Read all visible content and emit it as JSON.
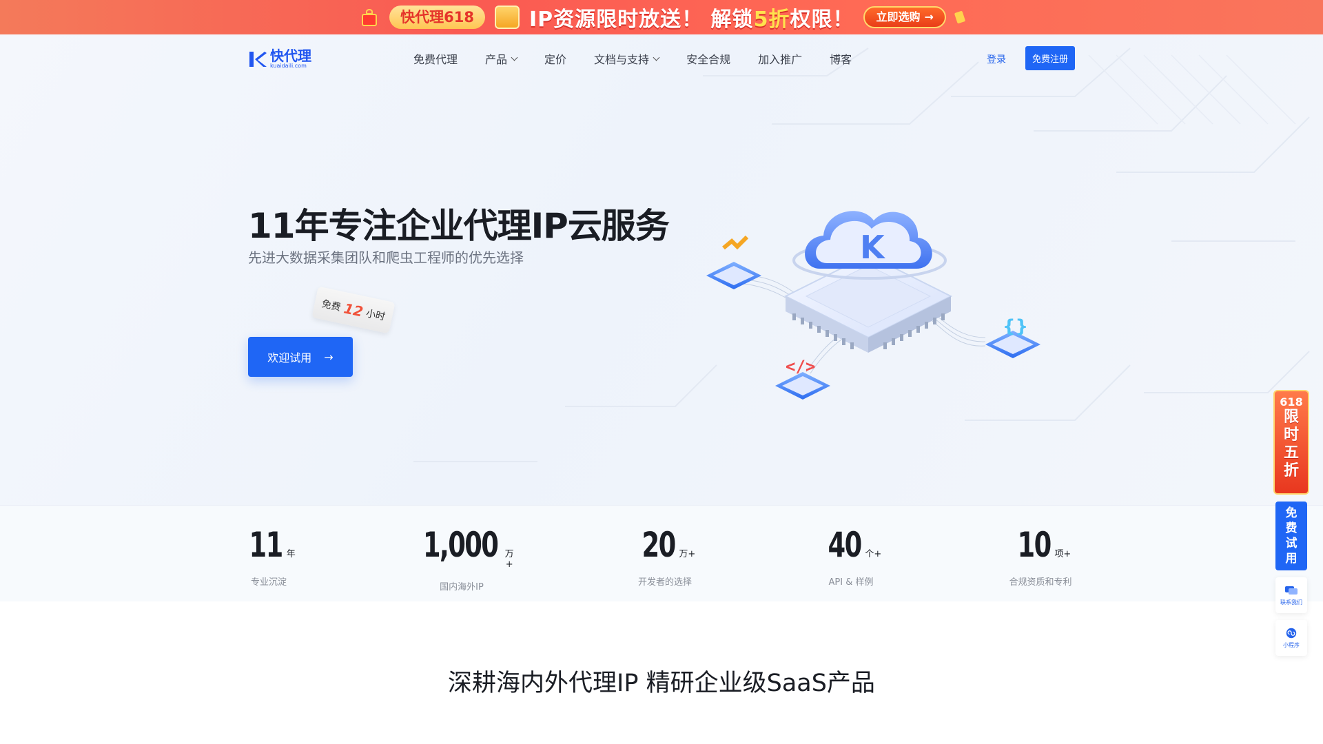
{
  "promo": {
    "chip": "快代理618",
    "headline_prefix": "IP资源限时放送！ 解锁",
    "headline_highlight": "5折",
    "headline_suffix": "权限！",
    "cta": "立即选购",
    "cta_arrow": "→"
  },
  "nav": {
    "logo_name": "快代理",
    "logo_domain": "kuaidaili.com",
    "items": [
      {
        "label": "免费代理",
        "dropdown": false
      },
      {
        "label": "产品",
        "dropdown": true
      },
      {
        "label": "定价",
        "dropdown": false
      },
      {
        "label": "文档与支持",
        "dropdown": true
      },
      {
        "label": "安全合规",
        "dropdown": false
      },
      {
        "label": "加入推广",
        "dropdown": false
      },
      {
        "label": "博客",
        "dropdown": false
      }
    ],
    "login": "登录",
    "register": "免费注册"
  },
  "hero": {
    "title": "11年专注企业代理IP云服务",
    "subtitle": "先进大数据采集团队和爬虫工程师的优先选择",
    "free_tag_prefix": "免费",
    "free_tag_num": "12",
    "free_tag_suffix": "小时",
    "cta": "欢迎试用",
    "cta_arrow": "→"
  },
  "stats": [
    {
      "value": "11",
      "unit": "年",
      "label": "专业沉淀"
    },
    {
      "value": "1,000",
      "unit": "万+",
      "label": "国内海外IP"
    },
    {
      "value": "20",
      "unit": "万+",
      "label": "开发者的选择"
    },
    {
      "value": "40",
      "unit": "个+",
      "label": "API & 样例"
    },
    {
      "value": "10",
      "unit": "项+",
      "label": "合规资质和专利"
    }
  ],
  "section": {
    "title": "深耕海内外代理IP 精研企业级SaaS产品"
  },
  "side": {
    "ad_top": "618",
    "ad_chars": [
      "限",
      "时",
      "五",
      "折"
    ],
    "trial_chars": [
      "免",
      "费",
      "试",
      "用"
    ],
    "contact": "联系我们",
    "miniapp": "小程序"
  },
  "colors": {
    "brand": "#1f66f5",
    "promo_red": "#fa5a52",
    "highlight_yellow": "#ffe24d"
  }
}
